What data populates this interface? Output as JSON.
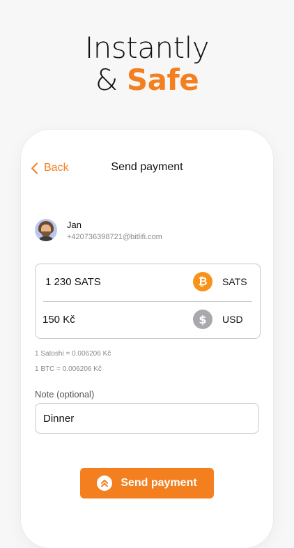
{
  "headline": {
    "line1": "Instantly",
    "amp": "&",
    "accent": "Safe"
  },
  "colors": {
    "accent": "#f47f1f",
    "bitcoin": "#f7931a",
    "usd_coin": "#a9a9ad"
  },
  "nav": {
    "back_label": "Back",
    "back_icon": "chevron-left-icon",
    "title": "Send payment"
  },
  "contact": {
    "name": "Jan",
    "detail": "+420736398721@bitlifi.com"
  },
  "amounts": {
    "sats": {
      "value": "1 230 SATS",
      "currency": "SATS",
      "icon": "bitcoin-icon"
    },
    "fiat": {
      "value": "150 Kč",
      "currency": "USD",
      "icon": "dollar-icon"
    }
  },
  "rates": {
    "satoshi": "1 Satoshi = 0.006206 Kč",
    "btc": "1 BTC = 0.006206 Kč"
  },
  "note": {
    "label": "Note (optional)",
    "value": "Dinner"
  },
  "send_button": {
    "label": "Send payment",
    "icon": "double-chevron-up-icon"
  }
}
